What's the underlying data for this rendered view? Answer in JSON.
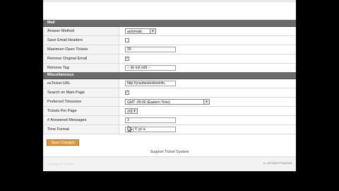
{
  "footer": {
    "text": "Support Ticket System",
    "brand": "osTicket Powered",
    "copyright": "Copyright © osTicket"
  },
  "section1": {
    "title": "Mail",
    "rows": [
      {
        "label": "Answer Method",
        "kind": "select",
        "value": "automatic"
      },
      {
        "label": "Save Email Headers",
        "kind": "checkbox",
        "checked": false
      },
      {
        "label": "Maximum Open Tickets",
        "kind": "text",
        "value": "20"
      },
      {
        "label": "Remove Original Email",
        "kind": "checkbox",
        "checked": true
      },
      {
        "label": "Remove Tag",
        "kind": "text",
        "value": "-- do not edit --"
      }
    ]
  },
  "misc": {
    "title": "Miscellaneous",
    "rows": [
      {
        "label": "osTicket URL",
        "kind": "text",
        "value": "http://yourbestonlineinfo."
      },
      {
        "label": "Search on Main Page",
        "kind": "checkbox",
        "checked": true
      },
      {
        "label": "Preferred Timezone",
        "kind": "select",
        "value": "GMT -05:00 (Eastern Time)"
      },
      {
        "label": "Tickets Per Page",
        "kind": "select",
        "value": "20"
      },
      {
        "label": "# Answered Messages",
        "kind": "text",
        "value": "3"
      },
      {
        "label": "Time Format",
        "kind": "text",
        "value": "l, F j Y, g:i a"
      }
    ]
  },
  "save_button": "Save Changes",
  "colors": {
    "accent": "#e29a2c",
    "header": "#6b6b6b"
  }
}
